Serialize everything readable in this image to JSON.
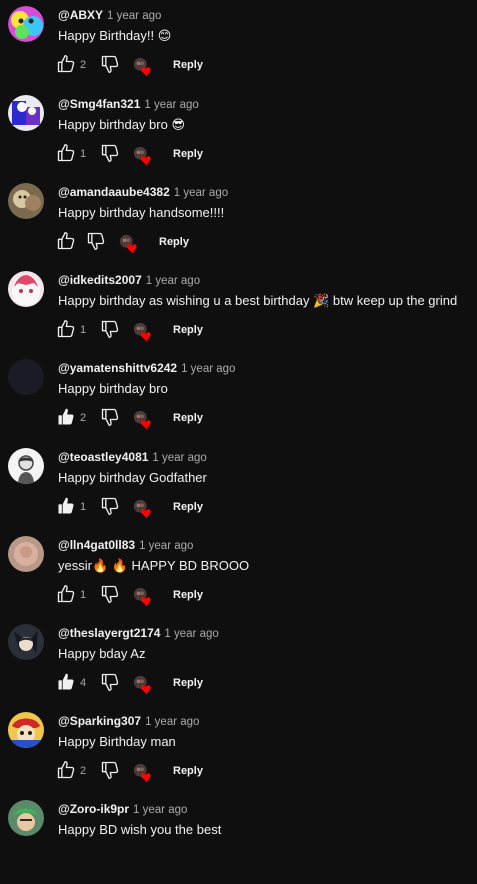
{
  "comments": [
    {
      "author": "@ABXY",
      "time": "1 year ago",
      "text": "Happy Birthday!! 😊",
      "likes": "2",
      "reply": "Reply",
      "liked": false,
      "avatar": "rainbow-face"
    },
    {
      "author": "@Smg4fan321",
      "time": "1 year ago",
      "text": "Happy birthday bro 😎",
      "likes": "1",
      "reply": "Reply",
      "liked": false,
      "avatar": "cartoon-character"
    },
    {
      "author": "@amandaaube4382",
      "time": "1 year ago",
      "text": "Happy birthday handsome!!!!",
      "likes": "",
      "reply": "Reply",
      "liked": false,
      "avatar": "photo-dog"
    },
    {
      "author": "@idkedits2007",
      "time": "1 year ago",
      "text": "Happy birthday as wishing u a best birthday 🎉  btw keep up the grind",
      "likes": "1",
      "reply": "Reply",
      "liked": false,
      "avatar": "anime-girl"
    },
    {
      "author": "@yamatenshittv6242",
      "time": "1 year ago",
      "text": "Happy birthday bro",
      "likes": "2",
      "reply": "Reply",
      "liked": true,
      "avatar": "dark-blank"
    },
    {
      "author": "@teoastley4081",
      "time": "1 year ago",
      "text": "Happy birthday Godfather",
      "likes": "1",
      "reply": "Reply",
      "liked": true,
      "avatar": "sketch-portrait"
    },
    {
      "author": "@lln4gat0ll83",
      "time": "1 year ago",
      "text": "yessir🔥 🔥 HAPPY BD BROOO",
      "likes": "1",
      "reply": "Reply",
      "liked": false,
      "avatar": "blurred-face"
    },
    {
      "author": "@theslayergt2174",
      "time": "1 year ago",
      "text": "Happy bday Az",
      "likes": "4",
      "reply": "Reply",
      "liked": true,
      "avatar": "anime-swordsman"
    },
    {
      "author": "@Sparking307",
      "time": "1 year ago",
      "text": "Happy Birthday man",
      "likes": "2",
      "reply": "Reply",
      "liked": false,
      "avatar": "cartoon-hat"
    },
    {
      "author": "@Zoro-ik9pr",
      "time": "1 year ago",
      "text": "Happy BD wish you the best",
      "likes": "",
      "reply": "",
      "liked": false,
      "avatar": "anime-zoro"
    }
  ],
  "colors": {
    "background": "#0f0f0f",
    "text": "#f1f1f1",
    "muted": "#aaaaaa",
    "heart": "#ff0000"
  },
  "icons": {
    "like": "thumbs-up-icon",
    "dislike": "thumbs-down-icon",
    "creator_heart": "creator-heart-icon"
  }
}
